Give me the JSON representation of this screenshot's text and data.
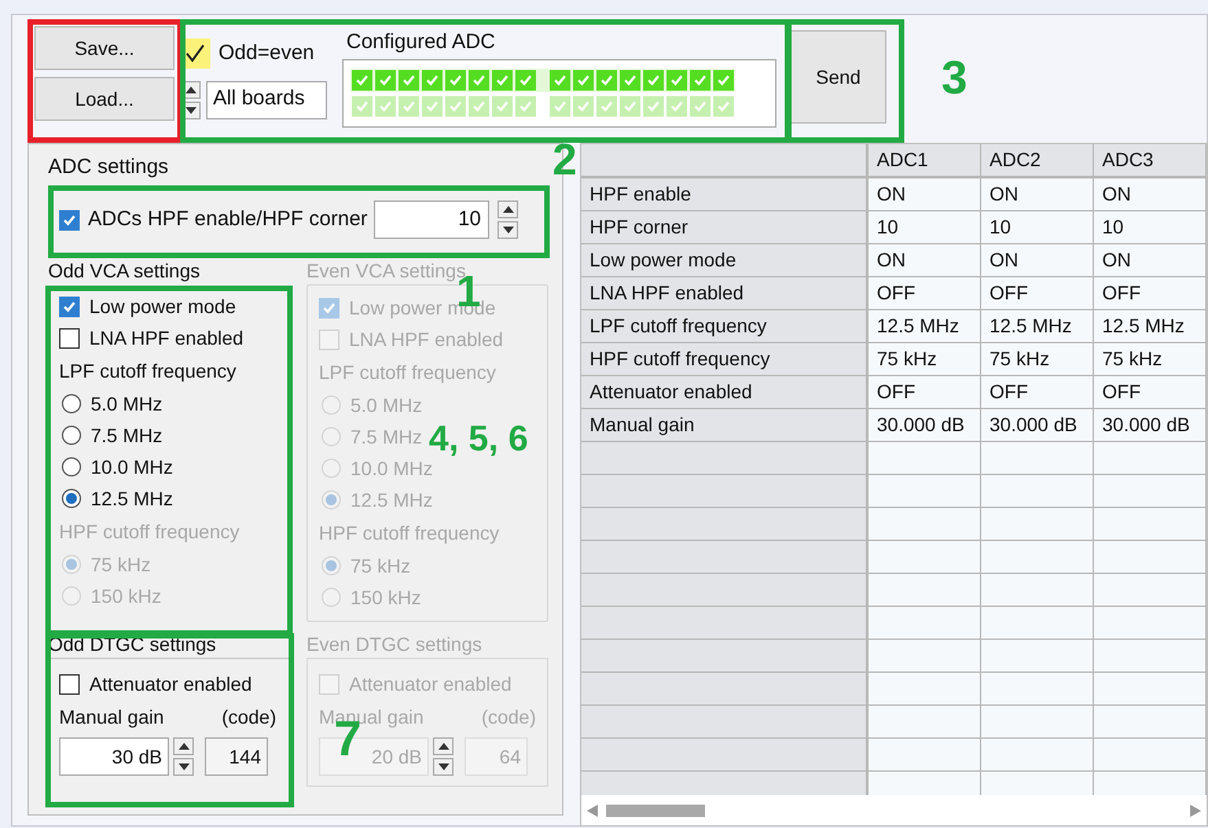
{
  "toolbar": {
    "save_button": "Save...",
    "load_button": "Load...",
    "odd_even": {
      "label": "Odd=even",
      "checked": true
    },
    "board_field": {
      "value": "All boards"
    },
    "configured_adc": {
      "label": "Configured ADC",
      "rows": [
        {
          "highlighted": true,
          "checks": [
            true,
            true,
            true,
            true,
            true,
            true,
            true,
            true,
            true,
            true,
            true,
            true,
            true,
            true,
            true,
            true
          ]
        },
        {
          "highlighted": false,
          "checks": [
            true,
            true,
            true,
            true,
            true,
            true,
            true,
            true,
            true,
            true,
            true,
            true,
            true,
            true,
            true,
            true
          ]
        }
      ]
    },
    "send_button": "Send"
  },
  "adc_settings": {
    "title": "ADC settings",
    "hpf": {
      "label": "ADCs HPF enable/HPF corner",
      "checked": true,
      "value": "10"
    }
  },
  "vca_panels": [
    {
      "title": "Odd VCA settings",
      "disabled": false,
      "checks": [
        {
          "label": "Low power mode",
          "checked": true
        },
        {
          "label": "LNA HPF enabled",
          "checked": false
        }
      ],
      "lpf": {
        "label": "LPF cutoff frequency",
        "disabled": false,
        "options": [
          {
            "label": "5.0 MHz",
            "selected": false
          },
          {
            "label": "7.5 MHz",
            "selected": false
          },
          {
            "label": "10.0 MHz",
            "selected": false
          },
          {
            "label": "12.5 MHz",
            "selected": true
          }
        ]
      },
      "hpf": {
        "label": "HPF cutoff frequency",
        "disabled": true,
        "options": [
          {
            "label": "75 kHz",
            "selected": true
          },
          {
            "label": "150 kHz",
            "selected": false
          }
        ]
      }
    },
    {
      "title": "Even VCA settings",
      "disabled": true,
      "checks": [
        {
          "label": "Low power mode",
          "checked": true
        },
        {
          "label": "LNA HPF enabled",
          "checked": false
        }
      ],
      "lpf": {
        "label": "LPF cutoff frequency",
        "disabled": true,
        "options": [
          {
            "label": "5.0 MHz",
            "selected": false
          },
          {
            "label": "7.5 MHz",
            "selected": false
          },
          {
            "label": "10.0 MHz",
            "selected": false
          },
          {
            "label": "12.5 MHz",
            "selected": true
          }
        ]
      },
      "hpf": {
        "label": "HPF cutoff frequency",
        "disabled": true,
        "options": [
          {
            "label": "75 kHz",
            "selected": true
          },
          {
            "label": "150 kHz",
            "selected": false
          }
        ]
      }
    }
  ],
  "dtgc_panels": [
    {
      "title": "Odd DTGC settings",
      "disabled": false,
      "attenuator": {
        "label": "Attenuator enabled",
        "checked": false
      },
      "gain_label": "Manual gain",
      "code_label": "(code)",
      "gain_value": "30 dB",
      "code_value": "144"
    },
    {
      "title": "Even DTGC settings",
      "disabled": true,
      "attenuator": {
        "label": "Attenuator enabled",
        "checked": false
      },
      "gain_label": "Manual gain",
      "code_label": "(code)",
      "gain_value": "20 dB",
      "code_value": "64"
    }
  ],
  "table": {
    "columns": [
      "ADC1",
      "ADC2",
      "ADC3"
    ],
    "rows": [
      {
        "label": "HPF enable",
        "cells": [
          "ON",
          "ON",
          "ON"
        ]
      },
      {
        "label": "HPF corner",
        "cells": [
          "10",
          "10",
          "10"
        ]
      },
      {
        "label": "Low power mode",
        "cells": [
          "ON",
          "ON",
          "ON"
        ]
      },
      {
        "label": "LNA HPF enabled",
        "cells": [
          "OFF",
          "OFF",
          "OFF"
        ]
      },
      {
        "label": "LPF cutoff frequency",
        "cells": [
          "12.5 MHz",
          "12.5 MHz",
          "12.5 MHz"
        ]
      },
      {
        "label": "HPF cutoff frequency",
        "cells": [
          "75 kHz",
          "75 kHz",
          "75 kHz"
        ]
      },
      {
        "label": "Attenuator enabled",
        "cells": [
          "OFF",
          "OFF",
          "OFF"
        ]
      },
      {
        "label": "Manual gain",
        "cells": [
          "30.000 dB",
          "30.000 dB",
          "30.000 dB"
        ]
      }
    ]
  },
  "annotations": [
    {
      "kind": "box",
      "color": "#e8202a"
    },
    {
      "kind": "box",
      "color": "#22aa44"
    },
    {
      "kind": "box",
      "color": "#22aa44"
    },
    {
      "kind": "box",
      "color": "#22aa44"
    },
    {
      "kind": "box",
      "color": "#22aa44"
    },
    {
      "kind": "box",
      "color": "#22aa44"
    },
    {
      "kind": "number",
      "label": "1",
      "color": "#22aa44"
    },
    {
      "kind": "number",
      "label": "2",
      "color": "#22aa44"
    },
    {
      "kind": "number",
      "label": "3",
      "color": "#22aa44"
    },
    {
      "kind": "number",
      "label": "4, 5, 6",
      "color": "#22aa44"
    },
    {
      "kind": "number",
      "label": "7",
      "color": "#22aa44"
    }
  ]
}
